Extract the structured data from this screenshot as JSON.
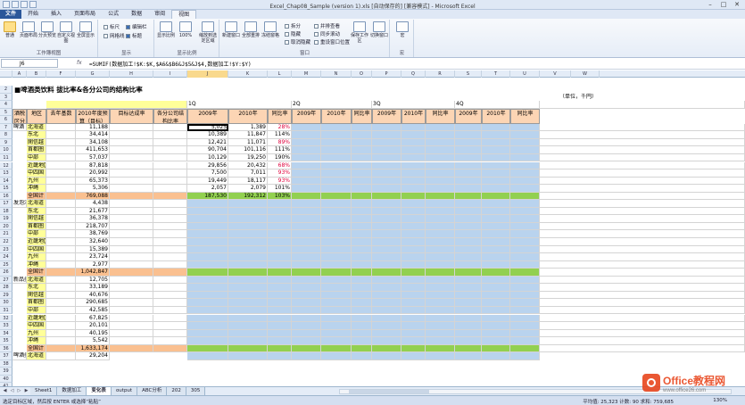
{
  "window": {
    "title": "Excel_Chap08_Sample (version 1).xls [自动保存的] [兼容模式] - Microsoft Excel"
  },
  "tabs": [
    "文件",
    "开始",
    "插入",
    "页面布局",
    "公式",
    "数据",
    "审阅",
    "视图"
  ],
  "ribbon": {
    "groups": [
      "工作簿视图",
      "显示",
      "显示比例",
      "窗口",
      "宏"
    ],
    "buttons": [
      "普通",
      "页面布局",
      "分页预览",
      "自定义视图",
      "全屏显示",
      "显示比例",
      "100%",
      "缩放到选定区域",
      "新建窗口",
      "全部重排",
      "冻结窗格",
      "保存工作区",
      "切换窗口",
      "宏"
    ],
    "checks": [
      "标尺",
      "编辑栏",
      "网格线",
      "标题"
    ],
    "window_opts": [
      "拆分",
      "隐藏",
      "取消隐藏",
      "并排查看",
      "同步滚动",
      "重设窗口位置"
    ]
  },
  "namebox": "J6",
  "fx": "fx",
  "formula": "=SUMIF(数据加工!$K:$K,$A6&$B6&J$5&J$4,数据加工!$Y:$Y)",
  "columns": [
    "A",
    "B",
    "F",
    "G",
    "H",
    "I",
    "J",
    "K",
    "L",
    "M",
    "N",
    "O",
    "P",
    "Q",
    "R",
    "S",
    "T",
    "U",
    "V",
    "W"
  ],
  "sheet": {
    "title": "■啤酒类饮料 拔比率&各分公司的结构比率",
    "unit": "（单位，千円）",
    "headers": {
      "cat": "酒税区分",
      "region": "地区",
      "last_year": "去年基数",
      "budget": "2010年度预算（目标）",
      "achieve": "目标达成率",
      "share": "各分公司结构比率",
      "y2009": "2009年",
      "y2010": "2010年",
      "ratio": "同比率"
    },
    "quarters": [
      "1Q",
      "2Q",
      "3Q",
      "4Q"
    ],
    "categories": [
      "啤酒",
      "发泡酒",
      "新品类",
      "啤酒类合计"
    ],
    "regions": [
      "北海道",
      "东北",
      "関信越",
      "首都圏",
      "中部",
      "近畿地区",
      "中四国",
      "九州",
      "冲绳",
      "全国计"
    ],
    "beer": {
      "budget": [
        "11,188",
        "34,414",
        "34,108",
        "411,653",
        "57,037",
        "87,818",
        "20,992",
        "65,373",
        "5,306",
        "769,088"
      ],
      "y2009": [
        "5,025",
        "10,389",
        "12,421",
        "90,704",
        "10,129",
        "29,856",
        "7,500",
        "19,449",
        "2,057",
        "187,530"
      ],
      "y2010": [
        "1,389",
        "11,847",
        "11,071",
        "101,116",
        "19,250",
        "20,432",
        "7,011",
        "18,117",
        "2,079",
        "192,312"
      ],
      "ratio": [
        "28%",
        "114%",
        "89%",
        "111%",
        "190%",
        "68%",
        "93%",
        "93%",
        "101%",
        "103%"
      ]
    },
    "happoshu": {
      "budget": [
        "4,438",
        "21,677",
        "36,378",
        "218,707",
        "38,769",
        "32,640",
        "15,389",
        "23,724",
        "2,977",
        "1,042,847"
      ]
    },
    "newgenre": {
      "budget": [
        "12,705",
        "33,189",
        "40,676",
        "290,685",
        "42,585",
        "67,825",
        "20,101",
        "40,195",
        "5,542",
        "1,633,174"
      ]
    },
    "total": {
      "first": "29,204"
    }
  },
  "sheet_tabs": [
    "Sheet1",
    "数据加工",
    "变化表",
    "output",
    "ABC分析",
    "202",
    "305"
  ],
  "status": {
    "left": "选定目标区域，然后按 ENTER 或选择“粘贴”",
    "sum": "平均值: 25,323   计数: 90   求和: 759,685",
    "zoom": "130%"
  },
  "watermark": {
    "brand": "Office教程网",
    "url": "www.office26.com"
  }
}
